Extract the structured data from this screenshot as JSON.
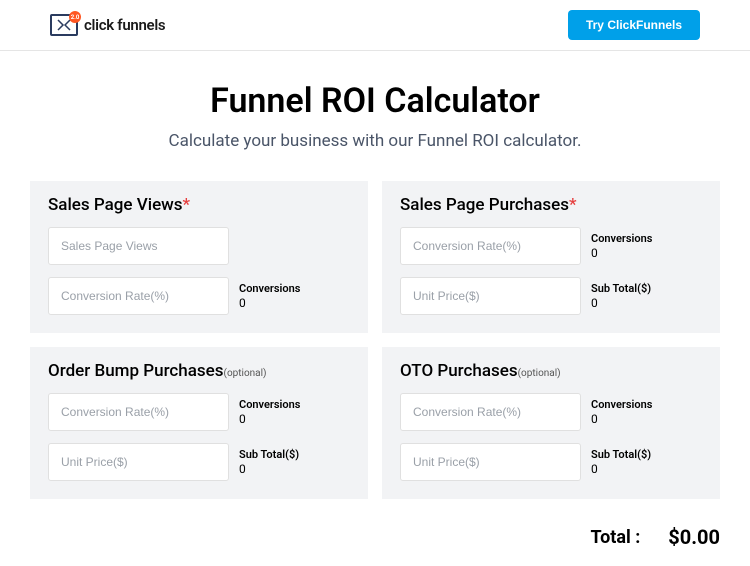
{
  "header": {
    "brand_text": "click funnels",
    "logo_badge": "2.0",
    "cta_label": "Try ClickFunnels"
  },
  "page": {
    "title": "Funnel ROI Calculator",
    "subtitle": "Calculate your business with our Funnel ROI calculator."
  },
  "cards": {
    "sales_views": {
      "title": "Sales Page Views",
      "required_mark": "*",
      "input1_placeholder": "Sales Page Views",
      "input2_placeholder": "Conversion Rate(%)",
      "output1_label": "Conversions",
      "output1_value": "0"
    },
    "sales_purchases": {
      "title": "Sales Page Purchases",
      "required_mark": "*",
      "input1_placeholder": "Conversion Rate(%)",
      "output1_label": "Conversions",
      "output1_value": "0",
      "input2_placeholder": "Unit Price($)",
      "output2_label": "Sub Total($)",
      "output2_value": "0"
    },
    "order_bump": {
      "title": "Order Bump Purchases",
      "optional_text": "(optional)",
      "input1_placeholder": "Conversion Rate(%)",
      "output1_label": "Conversions",
      "output1_value": "0",
      "input2_placeholder": "Unit Price($)",
      "output2_label": "Sub Total($)",
      "output2_value": "0"
    },
    "oto": {
      "title": "OTO Purchases",
      "optional_text": "(optional)",
      "input1_placeholder": "Conversion Rate(%)",
      "output1_label": "Conversions",
      "output1_value": "0",
      "input2_placeholder": "Unit Price($)",
      "output2_label": "Sub Total($)",
      "output2_value": "0"
    }
  },
  "total": {
    "label": "Total :",
    "value": "$0.00"
  }
}
